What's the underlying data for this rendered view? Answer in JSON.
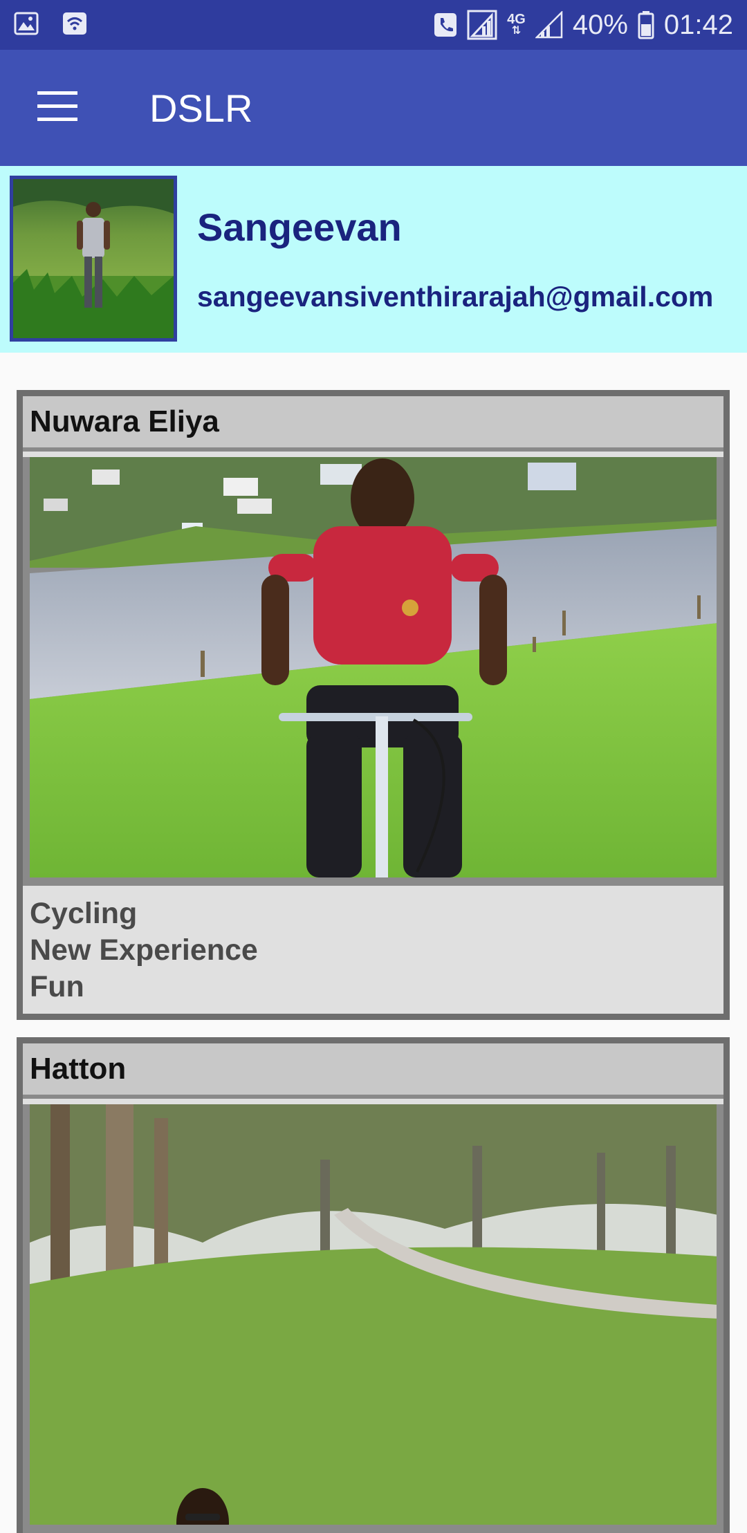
{
  "status_bar": {
    "network_type": "4G",
    "battery_percent": "40%",
    "time": "01:42"
  },
  "app_bar": {
    "title": "DSLR"
  },
  "profile": {
    "name": "Sangeevan",
    "email": "sangeevansiventhirarajah@gmail.com"
  },
  "posts": [
    {
      "location": "Nuwara Eliya",
      "tags": [
        "Cycling",
        "New Experience",
        "Fun"
      ]
    },
    {
      "location": "Hatton",
      "tags": []
    }
  ],
  "colors": {
    "status_bar": "#2f3c9e",
    "app_bar": "#3f51b5",
    "profile_bg": "#bdfcfc",
    "profile_text": "#1a237e"
  }
}
